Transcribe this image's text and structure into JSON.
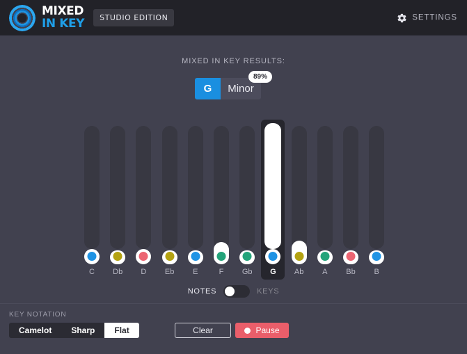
{
  "header": {
    "logo_line1": "MIXED",
    "logo_line2": "IN KEY",
    "edition_badge": "STUDIO EDITION",
    "settings_label": "SETTINGS",
    "settings_icon": "gear-icon",
    "bg_color": "#222228",
    "logo_accent": "#1f9fe8"
  },
  "results": {
    "label": "MIXED IN KEY RESULTS:",
    "key": "G",
    "scale": "Minor",
    "confidence": "89%",
    "key_color": "#1a8fe0",
    "scale_color": "#4c4c5c"
  },
  "graph": {
    "notes": [
      {
        "label": "C",
        "dot_color": "#1f93e4",
        "bar_value": 0,
        "pill_height": 22,
        "active": false
      },
      {
        "label": "Db",
        "dot_color": "#b4a211",
        "bar_value": 0,
        "pill_height": 20,
        "active": false
      },
      {
        "label": "D",
        "dot_color": "#ec6572",
        "bar_value": 0,
        "pill_height": 22,
        "active": false
      },
      {
        "label": "Eb",
        "dot_color": "#b4a211",
        "bar_value": 0,
        "pill_height": 20,
        "active": false
      },
      {
        "label": "E",
        "dot_color": "#1f93e4",
        "bar_value": 0,
        "pill_height": 20,
        "active": false
      },
      {
        "label": "F",
        "dot_color": "#23a37a",
        "bar_value": 0,
        "pill_height": 32,
        "active": false
      },
      {
        "label": "Gb",
        "dot_color": "#23a37a",
        "bar_value": 0,
        "pill_height": 20,
        "active": false
      },
      {
        "label": "G",
        "dot_color": "#1f93e4",
        "bar_value": 100,
        "pill_height": 22,
        "active": true
      },
      {
        "label": "Ab",
        "dot_color": "#b4a211",
        "bar_value": 0,
        "pill_height": 34,
        "active": false
      },
      {
        "label": "A",
        "dot_color": "#23a37a",
        "bar_value": 0,
        "pill_height": 20,
        "active": false
      },
      {
        "label": "Bb",
        "dot_color": "#ec6572",
        "bar_value": 0,
        "pill_height": 20,
        "active": false
      },
      {
        "label": "B",
        "dot_color": "#1f93e4",
        "bar_value": 0,
        "pill_height": 20,
        "active": false
      }
    ]
  },
  "toggle": {
    "left_label": "NOTES",
    "right_label": "KEYS",
    "position": "left"
  },
  "footer": {
    "key_notation_label": "KEY NOTATION",
    "notation_options": [
      "Camelot",
      "Sharp",
      "Flat"
    ],
    "notation_selected": "Flat",
    "clear_label": "Clear",
    "pause_label": "Pause",
    "pause_color": "#ea5e6a"
  }
}
